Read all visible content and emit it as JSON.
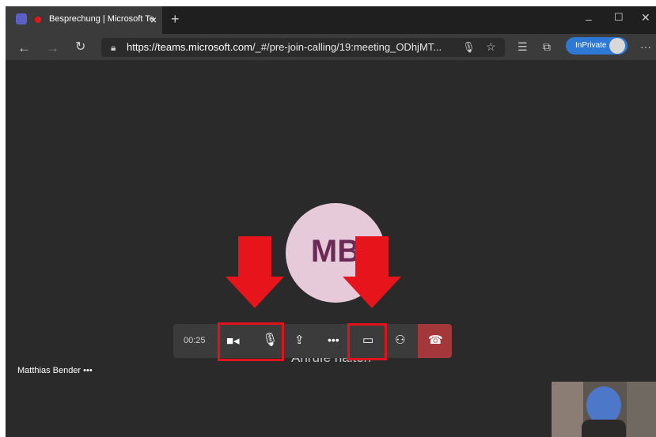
{
  "browser": {
    "tab_title": "Besprechung | Microsoft Te",
    "tab_close": "×",
    "new_tab": "+",
    "url_host": "https://teams.microsoft.com",
    "url_path": "/_#/pre-join-calling/19:meeting_ODhjMT...",
    "inprivate_label": "InPrivate"
  },
  "meeting": {
    "avatar_initials": "MB",
    "calling_status": "Anrufe halten",
    "participant_name": "Matthias Bender",
    "participant_more": "•••",
    "toolbar": {
      "timer": "00:25",
      "more_label": "•••"
    }
  },
  "colors": {
    "stage_bg": "#2b2a2a",
    "toolbar_bg": "#3c3b3b",
    "hangup": "#a4373a",
    "avatar_bg": "#e6cad9",
    "annotation_red": "#e8141b"
  }
}
